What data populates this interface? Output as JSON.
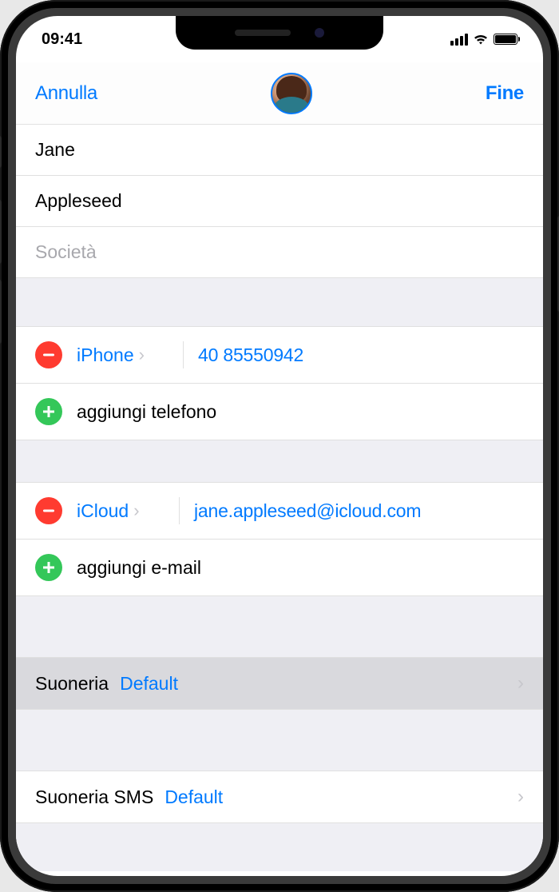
{
  "statusbar": {
    "time": "09:41"
  },
  "nav": {
    "cancel": "Annulla",
    "done": "Fine"
  },
  "fields": {
    "firstName": "Jane",
    "lastName": "Appleseed",
    "company_placeholder": "Società"
  },
  "phone": {
    "type": "iPhone",
    "number": "40 85550942",
    "add_label": "aggiungi telefono"
  },
  "email": {
    "type": "iCloud",
    "address": "jane.appleseed@icloud.com",
    "add_label": "aggiungi e-mail"
  },
  "ringtone": {
    "label": "Suoneria",
    "value": "Default"
  },
  "texttone": {
    "label": "Suoneria SMS",
    "value": "Default"
  }
}
